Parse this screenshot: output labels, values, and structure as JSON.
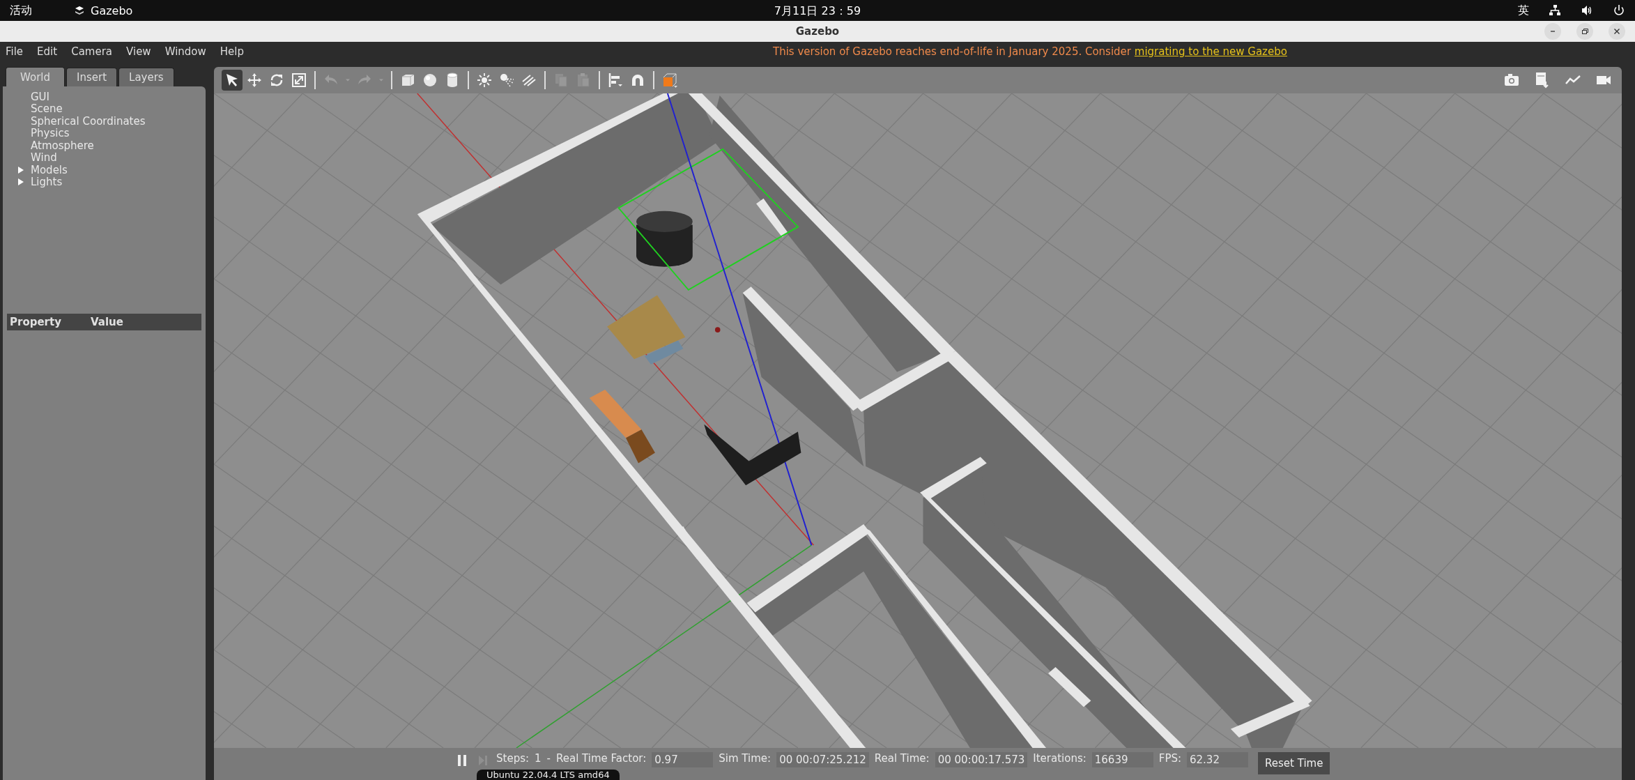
{
  "top_bar": {
    "activities": "活动",
    "app_name": "Gazebo",
    "clock": "7月11日  23：59",
    "input_method": "英"
  },
  "window": {
    "title": "Gazebo"
  },
  "menu": [
    "File",
    "Edit",
    "Camera",
    "View",
    "Window",
    "Help"
  ],
  "notice": {
    "text": "This version of Gazebo reaches end-of-life in January 2025. Consider ",
    "link": "migrating to the new Gazebo"
  },
  "tabs": [
    {
      "label": "World",
      "selected": true
    },
    {
      "label": "Insert",
      "selected": false
    },
    {
      "label": "Layers",
      "selected": false
    }
  ],
  "tree": [
    {
      "label": "GUI",
      "kind": "leaf"
    },
    {
      "label": "Scene",
      "kind": "leaf"
    },
    {
      "label": "Spherical Coordinates",
      "kind": "leaf"
    },
    {
      "label": "Physics",
      "kind": "leaf"
    },
    {
      "label": "Atmosphere",
      "kind": "leaf"
    },
    {
      "label": "Wind",
      "kind": "leaf"
    },
    {
      "label": "Models",
      "kind": "group",
      "expanded": false
    },
    {
      "label": "Lights",
      "kind": "group",
      "expanded": false
    }
  ],
  "property_table": {
    "columns": [
      "Property",
      "Value"
    ]
  },
  "toolbar": {
    "tools": [
      {
        "kind": "select",
        "selected": true,
        "disabled": false
      },
      {
        "kind": "translate",
        "selected": false,
        "disabled": false
      },
      {
        "kind": "rotate",
        "selected": false,
        "disabled": false
      },
      {
        "kind": "scale",
        "selected": false,
        "disabled": false
      },
      {
        "kind": "sep"
      },
      {
        "kind": "undo",
        "selected": false,
        "disabled": true
      },
      {
        "kind": "caret",
        "selected": false,
        "disabled": true
      },
      {
        "kind": "redo",
        "selected": false,
        "disabled": true
      },
      {
        "kind": "caret",
        "selected": false,
        "disabled": true
      },
      {
        "kind": "sep"
      },
      {
        "kind": "box",
        "selected": false,
        "disabled": false
      },
      {
        "kind": "sphere",
        "selected": false,
        "disabled": false
      },
      {
        "kind": "cylinder",
        "selected": false,
        "disabled": false
      },
      {
        "kind": "sep"
      },
      {
        "kind": "pointlight",
        "selected": false,
        "disabled": false
      },
      {
        "kind": "spotlight",
        "selected": false,
        "disabled": false
      },
      {
        "kind": "dirlight",
        "selected": false,
        "disabled": false
      },
      {
        "kind": "sep"
      },
      {
        "kind": "copy",
        "selected": false,
        "disabled": true
      },
      {
        "kind": "paste",
        "selected": false,
        "disabled": true
      },
      {
        "kind": "sep"
      },
      {
        "kind": "align",
        "selected": false,
        "disabled": false
      },
      {
        "kind": "magnet",
        "selected": false,
        "disabled": false
      },
      {
        "kind": "sep"
      },
      {
        "kind": "snapbox",
        "selected": false,
        "disabled": false
      }
    ],
    "right_tools": [
      {
        "kind": "camera"
      },
      {
        "kind": "log"
      },
      {
        "kind": "plot"
      },
      {
        "kind": "video"
      }
    ]
  },
  "bottom_bar": {
    "steps_label": "Steps:",
    "steps_value": "1",
    "steps_spin": "-",
    "fields": [
      {
        "label": "Real Time Factor:",
        "value": "0.97"
      },
      {
        "label": "Sim Time:",
        "value": "00 00:07:25.212"
      },
      {
        "label": "Real Time:",
        "value": "00 00:00:17.573"
      },
      {
        "label": "Iterations:",
        "value": "16639"
      },
      {
        "label": "FPS:",
        "value": "62.32"
      }
    ],
    "reset_button": "Reset Time",
    "paused": false
  },
  "tooltip": "Ubuntu 22.04.4 LTS amd64"
}
